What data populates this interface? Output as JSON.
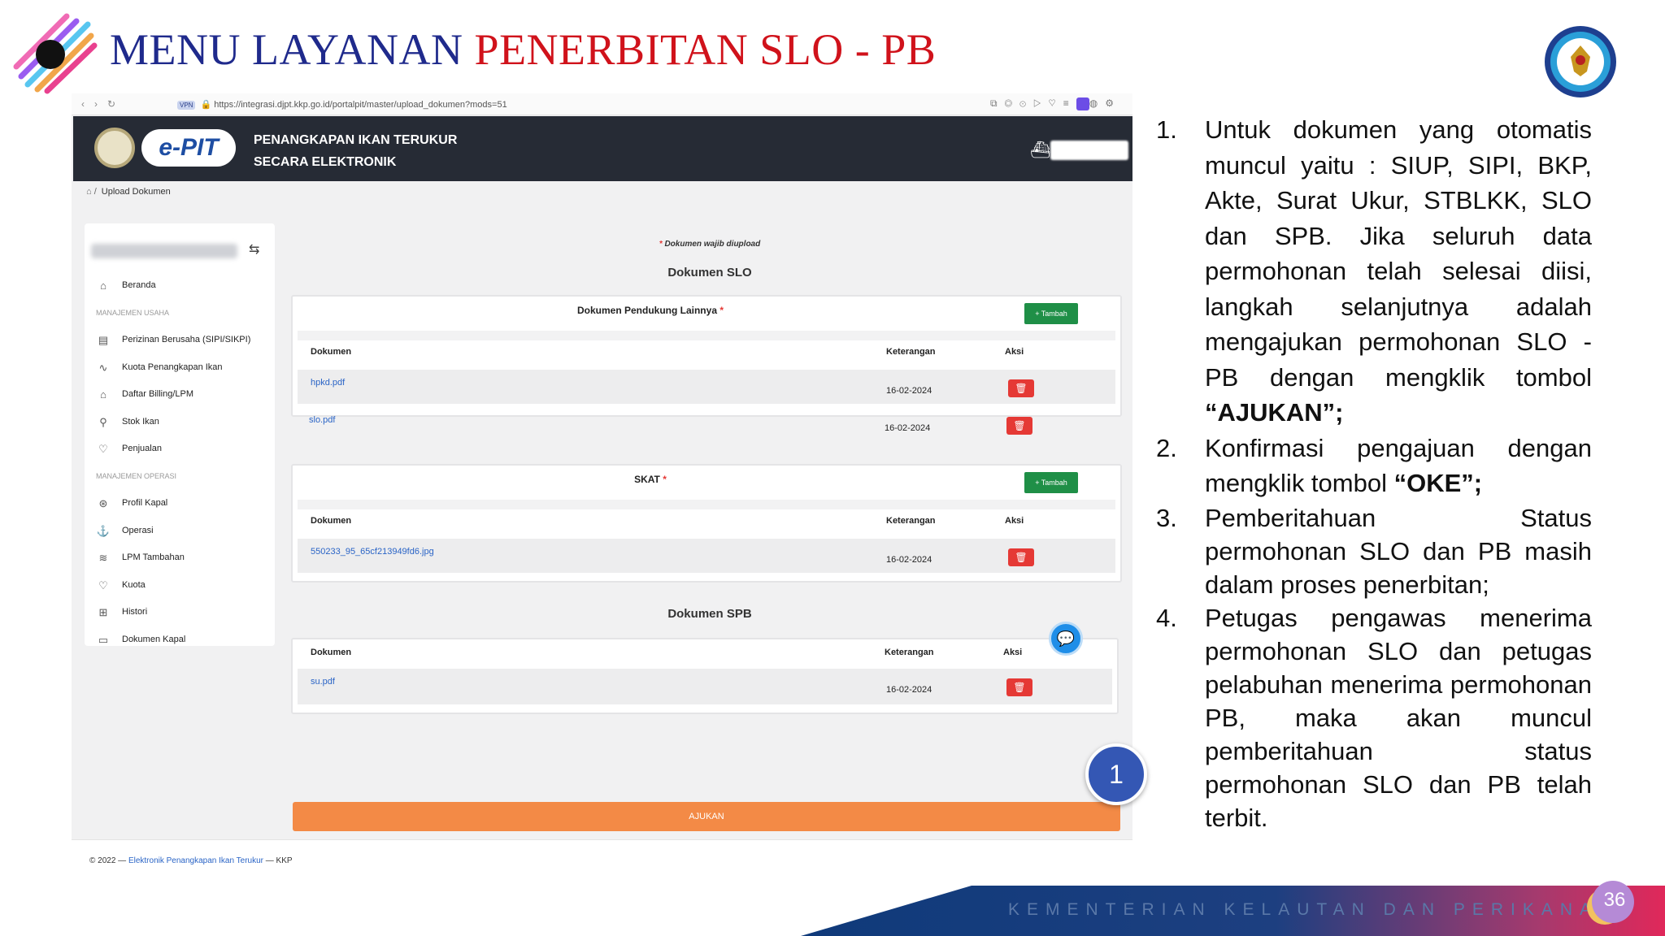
{
  "slide": {
    "title_part1": "MENU LAYANAN ",
    "title_part2": "PENERBITAN SLO - PB",
    "page_number": "36",
    "banner_text": "KEMENTERIAN KELAUTAN DAN PERIKANAN"
  },
  "browser": {
    "url": "https://integrasi.djpt.kkp.go.id/portalpit/master/upload_dokumen?mods=51",
    "vpn_label": "VPN"
  },
  "app": {
    "logo_text": "e-PIT",
    "title_line1": "PENANGKAPAN IKAN TERUKUR",
    "title_line2": "SECARA ELEKTRONIK",
    "breadcrumb_current": "Upload Dokumen"
  },
  "sidebar": {
    "items": [
      {
        "label": "Beranda",
        "icon": "home-icon",
        "glyph": "⌂",
        "type": "item"
      },
      {
        "label": "MANAJEMEN USAHA",
        "type": "section"
      },
      {
        "label": "Perizinan Berusaha (SIPI/SIKPI)",
        "icon": "license-icon",
        "glyph": "▤",
        "type": "item"
      },
      {
        "label": "Kuota Penangkapan Ikan",
        "icon": "activity-icon",
        "glyph": "∿",
        "type": "item"
      },
      {
        "label": "Daftar Billing/LPM",
        "icon": "bank-icon",
        "glyph": "⌂",
        "type": "item"
      },
      {
        "label": "Stok Ikan",
        "icon": "fish-icon",
        "glyph": "⚲",
        "type": "item"
      },
      {
        "label": "Penjualan",
        "icon": "handshake-icon",
        "glyph": "♡",
        "type": "item"
      },
      {
        "label": "MANAJEMEN OPERASI",
        "type": "section"
      },
      {
        "label": "Profil Kapal",
        "icon": "ship-wheel-icon",
        "glyph": "⊛",
        "type": "item"
      },
      {
        "label": "Operasi",
        "icon": "anchor-icon",
        "glyph": "⚓",
        "type": "item"
      },
      {
        "label": "LPM Tambahan",
        "icon": "layers-icon",
        "glyph": "≋",
        "type": "item"
      },
      {
        "label": "Kuota",
        "icon": "shield-heart-icon",
        "glyph": "♡",
        "type": "item"
      },
      {
        "label": "Histori",
        "icon": "history-icon",
        "glyph": "⊞",
        "type": "item"
      },
      {
        "label": "Dokumen Kapal",
        "icon": "archive-icon",
        "glyph": "▭",
        "type": "item"
      }
    ]
  },
  "main": {
    "required_note": "Dokumen wajib diupload",
    "slo_title": "Dokumen SLO",
    "spb_title": "Dokumen SPB",
    "tambah_label": "Tambah",
    "col_dokumen": "Dokumen",
    "col_keterangan": "Keterangan",
    "col_aksi": "Aksi",
    "cards": [
      {
        "title": "Dokumen Pendukung Lainnya",
        "rows": [
          {
            "file": "hpkd.pdf",
            "date": "16-02-2024"
          },
          {
            "file": "slo.pdf",
            "date": "16-02-2024"
          }
        ]
      },
      {
        "title": "SKAT",
        "rows": [
          {
            "file": "550233_95_65cf213949fd6.jpg",
            "date": "16-02-2024"
          }
        ]
      },
      {
        "title": "",
        "rows": [
          {
            "file": "su.pdf",
            "date": "16-02-2024"
          }
        ]
      }
    ],
    "submit_label": "AJUKAN"
  },
  "footer": {
    "prefix": "© 2022 — ",
    "link": "Elektronik Penangkapan Ikan Terukur",
    "suffix": " — KKP"
  },
  "step_badge": "1",
  "instructions": [
    {
      "num": "1.",
      "text": "Untuk dokumen yang otomatis muncul yaitu : SIUP, SIPI, BKP, Akte, Surat Ukur, STBLKK, SLO dan SPB. Jika seluruh data permohonan telah selesai diisi, langkah selanjutnya adalah mengajukan permohonan SLO - PB dengan mengklik tombol ",
      "bold": "“AJUKAN”;",
      "tail": ""
    },
    {
      "num": "2.",
      "text": "Konfirmasi pengajuan dengan mengklik tombol ",
      "bold": "“OKE”;",
      "tail": ""
    },
    {
      "num": "3.",
      "text": "Pemberitahuan Status permohonan SLO dan PB masih dalam proses penerbitan;",
      "bold": "",
      "tail": ""
    },
    {
      "num": "4.",
      "text": "Petugas pengawas menerima permohonan SLO dan petugas pelabuhan menerima permohonan PB, maka akan muncul pemberitahuan status permohonan SLO dan PB telah terbit.",
      "bold": "",
      "tail": ""
    }
  ],
  "colors": {
    "title_blue": "#1f2a8c",
    "title_red": "#d0121b",
    "header_dark": "#262b35",
    "tambah_green": "#1f8f47",
    "delete_red": "#e53935",
    "submit_orange": "#f38a46",
    "badge_blue": "#3457b4"
  }
}
